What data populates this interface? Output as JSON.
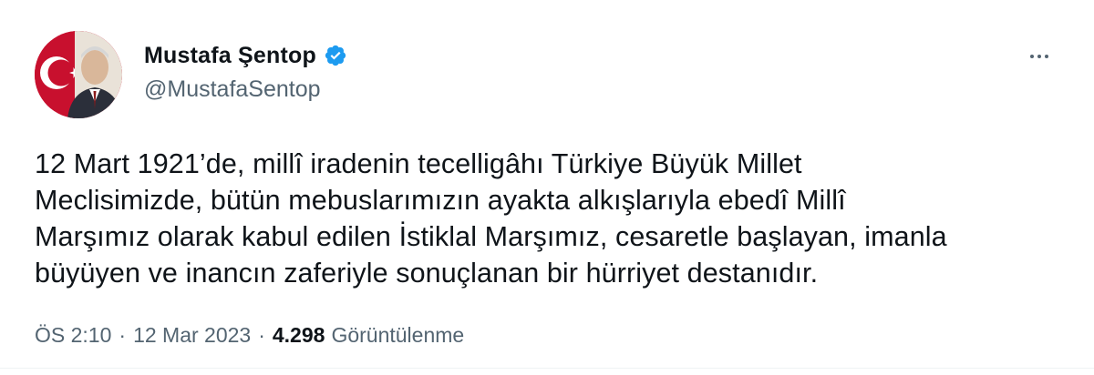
{
  "tweet": {
    "author": {
      "display_name": "Mustafa Şentop",
      "handle": "@MustafaSentop",
      "verified": true,
      "verified_icon": "verified-badge-icon",
      "verified_color": "#1d9bf0"
    },
    "more_icon": "more-horizontal-icon",
    "text": "12 Mart 1921’de, millî iradenin tecelligâhı Türkiye Büyük Millet\nMeclisimizde, bütün mebuslarımızın ayakta alkışlarıyla ebedî Millî\nMarşımız olarak kabul edilen İstiklal Marşımız, cesaretle başlayan, imanla\nbüyüyen ve inancın zaferiyle sonuçlanan bir hürriyet destanıdır.",
    "meta": {
      "time": "ÖS 2:10",
      "separator": "·",
      "date": "12 Mar 2023",
      "views_count": "4.298",
      "views_label": "Görüntülenme"
    }
  },
  "colors": {
    "text_primary": "#0f1419",
    "text_secondary": "#536471",
    "accent": "#1d9bf0",
    "avatar_background": "#c8102e"
  }
}
